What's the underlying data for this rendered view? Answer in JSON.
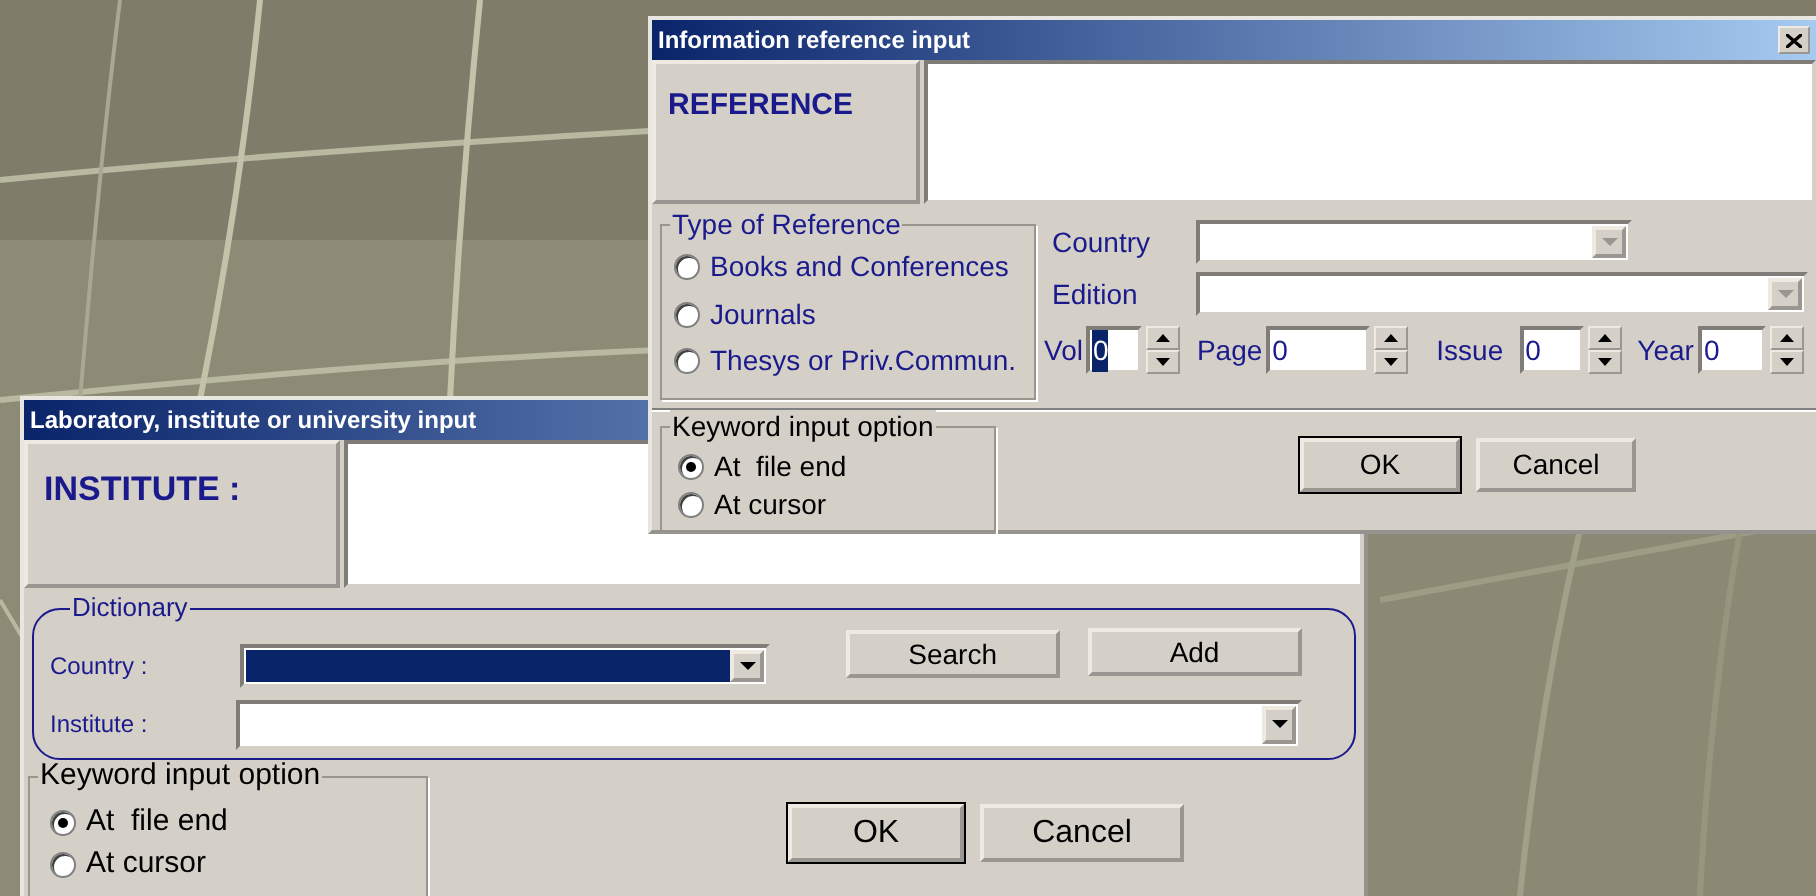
{
  "institute_window": {
    "title": "Laboratory, institute or university input",
    "institute_label": "INSTITUTE :",
    "dictionary": {
      "title": "Dictionary",
      "country_label": "Country :",
      "country_highlighted": true,
      "institute_label": "Institute :",
      "buttons": [
        "Search",
        "Add"
      ]
    },
    "keyword_option": {
      "title": "Keyword input option",
      "options": [
        {
          "label": "At  file end",
          "selected": true
        },
        {
          "label": "At cursor",
          "selected": false
        }
      ]
    },
    "buttons": [
      "OK",
      "Cancel"
    ]
  },
  "reference_window": {
    "title": "Information reference input",
    "reference_label": "REFERENCE",
    "type_of_reference": {
      "title": "Type of Reference",
      "options": [
        {
          "label": "Books and Conferences",
          "selected": false
        },
        {
          "label": "Journals",
          "selected": false
        },
        {
          "label": "Thesys or Priv.Commun.",
          "selected": false
        }
      ]
    },
    "country_label": "Country",
    "edition_label": "Edition",
    "spinners": [
      {
        "label": "Vol",
        "value": "0",
        "text_selected": true
      },
      {
        "label": "Page",
        "value": "0",
        "text_selected": false
      },
      {
        "label": "Issue",
        "value": "0",
        "text_selected": false
      },
      {
        "label": "Year",
        "value": "0",
        "text_selected": false
      }
    ],
    "keyword_option": {
      "title": "Keyword input option",
      "options": [
        {
          "label": "At  file end",
          "selected": true
        },
        {
          "label": "At cursor",
          "selected": false
        }
      ]
    },
    "buttons": [
      "OK",
      "Cancel"
    ]
  }
}
